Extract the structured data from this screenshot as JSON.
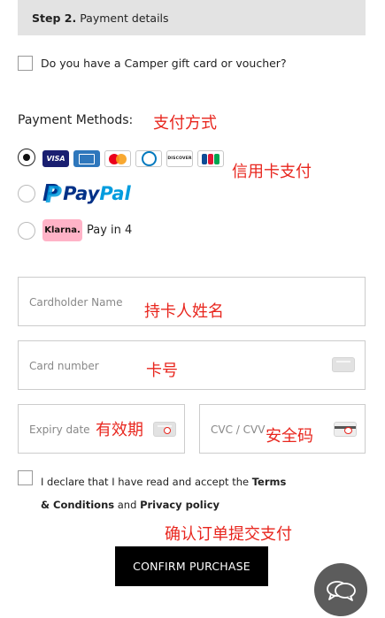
{
  "step": {
    "number_label": "Step 2.",
    "title": "Payment details"
  },
  "gift_card": {
    "label": "Do you have a Camper gift card or voucher?",
    "checked": false
  },
  "payment_methods": {
    "label": "Payment Methods:",
    "label_annotation": "支付方式",
    "selected": "cards",
    "cards": {
      "annotation": "信用卡支付",
      "logos": [
        "visa-icon",
        "amex-icon",
        "mastercard-icon",
        "diners-club-icon",
        "discover-icon",
        "jcb-icon"
      ],
      "visa_text": "VISA",
      "discover_text": "DISCOVER"
    },
    "paypal": {
      "pay": "Pay",
      "pal": "Pal"
    },
    "klarna": {
      "badge": "Klarna.",
      "text": "Pay in 4"
    }
  },
  "form": {
    "cardholder": {
      "placeholder": "Cardholder Name",
      "annotation": "持卡人姓名",
      "value": ""
    },
    "card_number": {
      "placeholder": "Card number",
      "annotation": "卡号",
      "value": ""
    },
    "expiry": {
      "placeholder": "Expiry date",
      "annotation": "有效期",
      "value": ""
    },
    "cvc": {
      "placeholder": "CVC / CVV",
      "annotation": "安全码",
      "value": ""
    }
  },
  "declaration": {
    "prefix": "I declare that I have read and accept the ",
    "terms": "Terms & Conditions",
    "and": " and ",
    "privacy": "Privacy policy",
    "checked": false
  },
  "confirm": {
    "annotation": "确认订单提交支付",
    "label": "CONFIRM PURCHASE"
  },
  "colors": {
    "annotation_red": "#e8261e",
    "button_black": "#000000",
    "step_bar_gray": "#e3e3e3",
    "klarna_pink": "#ffb3c7",
    "paypal_dark_blue": "#003087",
    "paypal_light_blue": "#009cde"
  }
}
